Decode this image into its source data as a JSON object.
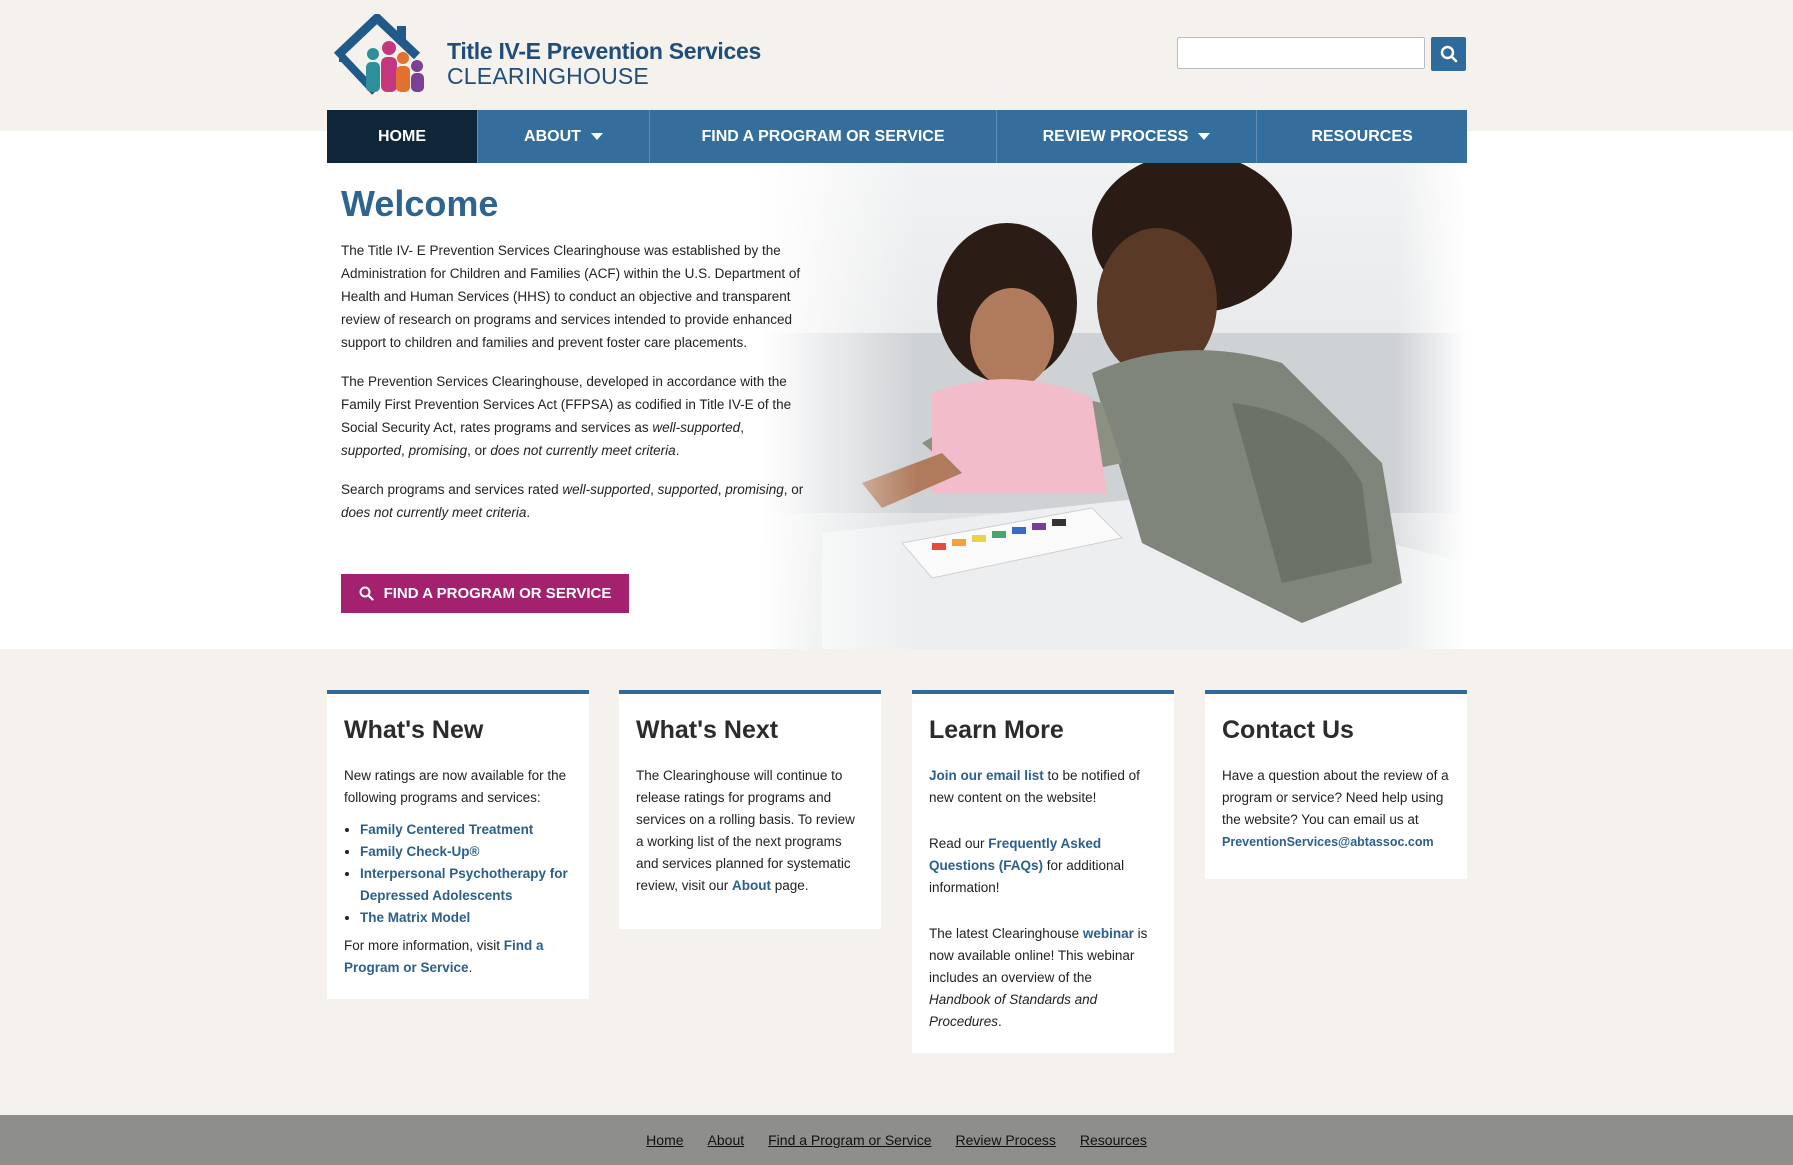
{
  "header": {
    "logo_title": "Title IV-E Prevention Services",
    "logo_subtitle": "CLEARINGHOUSE",
    "search_placeholder": ""
  },
  "nav": {
    "home": "HOME",
    "about": "ABOUT",
    "find": "FIND A PROGRAM OR SERVICE",
    "review": "REVIEW PROCESS",
    "resources": "RESOURCES"
  },
  "hero": {
    "title": "Welcome",
    "p1": "The Title IV- E Prevention Services Clearinghouse was established by the Administration for Children and Families (ACF) within the U.S. Department of Health and Human Services (HHS) to conduct an objective and transparent review of research on programs and services intended to provide enhanced support to children and families and prevent foster care placements.",
    "p2_a": "The Prevention Services Clearinghouse, developed in accordance with the Family First Prevention Services Act (FFPSA) as codified in Title IV-E of the Social Security Act, rates programs and services as ",
    "p2_ws": "well-supported",
    "p2_sep1": ", ",
    "p2_s": "supported",
    "p2_sep2": ", ",
    "p2_p": "promising",
    "p2_or": ", or ",
    "p2_d": "does not currently meet criteria",
    "p2_end": ".",
    "p3_a": "Search programs and services rated ",
    "p3_ws": "well-supported",
    "p3_sep1": ", ",
    "p3_s": "supported",
    "p3_sep2": ", ",
    "p3_p": "promising",
    "p3_or": ", or ",
    "p3_d": "does not currently meet criteria",
    "p3_end": ".",
    "cta": "FIND A PROGRAM OR SERVICE"
  },
  "cards": {
    "new": {
      "title": "What's New",
      "intro": "New ratings are now available for the following programs and services:",
      "items": [
        "Family Centered Treatment",
        "Family Check-Up®",
        "Interpersonal Psychotherapy for Depressed Adolescents",
        "The Matrix Model"
      ],
      "more_a": "For more information, visit ",
      "more_link": "Find a Program or Service",
      "more_end": "."
    },
    "next": {
      "title": "What's Next",
      "body": "The Clearinghouse will continue to release ratings for programs and services on a rolling basis. To review a working list of the next programs and services planned for systematic review, visit our ",
      "link": "About",
      "end": " page."
    },
    "learn": {
      "title": "Learn More",
      "l1_link": "Join our email list",
      "l1_text": " to be notified of new content on the website!",
      "l2_a": "Read our ",
      "l2_link": "Frequently Asked Questions (FAQs)",
      "l2_text": " for additional information!",
      "l3_a": "The latest Clearinghouse ",
      "l3_link": "webinar",
      "l3_text": " is now available online! This webinar includes an overview of the ",
      "l3_em": "Handbook of Standards and Procedures",
      "l3_end": "."
    },
    "contact": {
      "title": "Contact Us",
      "body": "Have a question about the review of a program or service? Need help using the website? You can email us at ",
      "email": "PreventionServices@abtassoc.com"
    }
  },
  "footer": {
    "links": [
      "Home",
      "About",
      "Find a Program or Service",
      "Review Process",
      "Resources"
    ]
  },
  "colors": {
    "nav": "#336e9c",
    "nav_active": "#0f2538",
    "cta": "#a4216f",
    "link": "#2b5f8c",
    "footer": "#8e8f8c"
  }
}
